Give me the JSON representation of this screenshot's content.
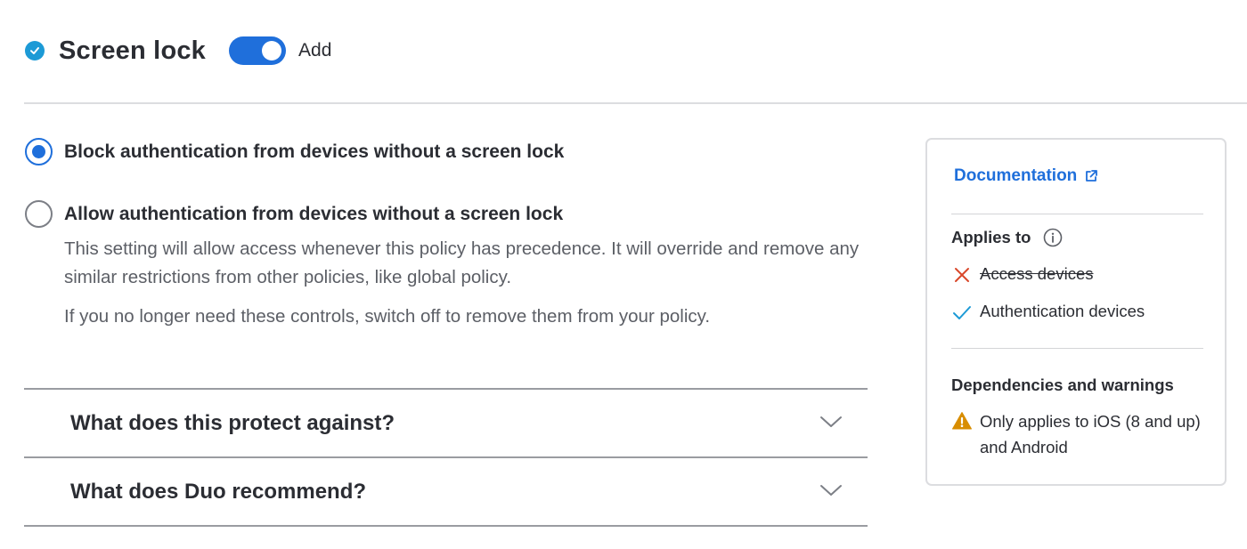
{
  "header": {
    "title": "Screen lock",
    "toggle_label": "Add",
    "toggle_on": true
  },
  "options": [
    {
      "label": "Block authentication from devices without a screen lock",
      "selected": true
    },
    {
      "label": "Allow authentication from devices without a screen lock",
      "selected": false
    }
  ],
  "description": {
    "paragraph1": "This setting will allow access whenever this policy has precedence. It will override and remove any similar restrictions from other policies, like global policy.",
    "paragraph2": "If you no longer need these controls, switch off to remove them from your policy."
  },
  "accordion": [
    {
      "title": "What does this protect against?"
    },
    {
      "title": "What does Duo recommend?"
    }
  ],
  "panel": {
    "documentation_label": "Documentation",
    "applies_to_heading": "Applies to",
    "applies_to": [
      {
        "label": "Access devices",
        "applies": false,
        "icon": "x-icon"
      },
      {
        "label": "Authentication devices",
        "applies": true,
        "icon": "check-icon"
      }
    ],
    "dependencies_heading": "Dependencies and warnings",
    "warning_text": "Only applies to iOS (8 and up) and Android"
  },
  "colors": {
    "accent": "#1f6fdb",
    "status_dot": "#1c9ad6",
    "error": "#d9482b",
    "success": "#1c9ad6",
    "warning": "#d88d00"
  }
}
